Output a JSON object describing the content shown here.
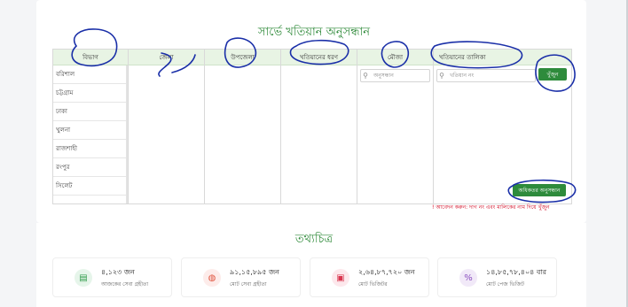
{
  "page": {
    "main_title": "সার্ভে খতিয়ান অনুসন্ধান",
    "info_title": "তথ্যচিত্র"
  },
  "columns": {
    "division": "বিভাগ",
    "district": "জেলা",
    "upazila": "উপজেলা",
    "khatian_type": "খতিয়ানের ধরণ",
    "mouza": "মৌজা",
    "khatian_list": "খতিয়ানের তালিকা"
  },
  "divisions": [
    "বরিশাল",
    "চট্টগ্রাম",
    "ঢাকা",
    "খুলনা",
    "রাজশাহী",
    "রংপুর",
    "সিলেট"
  ],
  "mouza_search": {
    "placeholder": "অনুসন্ধান"
  },
  "khatian_search": {
    "placeholder": "খতিয়ান নং"
  },
  "buttons": {
    "search": "খুঁজুন",
    "advanced_search": "অধিকতর অনুসন্ধান"
  },
  "notice": "! আবেদন করুন: দাগ নং এবং মালিকের নাম দিয়ে খুঁজুন",
  "stats": [
    {
      "value": "৪,১২৩ জন",
      "label": "আজকের সেবা গ্রহীতা",
      "icon": "document-icon",
      "color": "#2e9b4a",
      "bg": "#e6f5ea"
    },
    {
      "value": "৯১,১৫,৮৯৫ জন",
      "label": "মোট সেবা গ্রহীতা",
      "icon": "globe-icon",
      "color": "#e0523c",
      "bg": "#fdecea"
    },
    {
      "value": "২,৬৪,৮৭,৭২০ জন",
      "label": "মোট ভিজিটর",
      "icon": "file-icon",
      "color": "#d9364f",
      "bg": "#fde8ec"
    },
    {
      "value": "১৪,৮৫,৭৮,৪০৪ বার",
      "label": "মোট পেজ ভিজিট",
      "icon": "percent-icon",
      "color": "#8a4fbf",
      "bg": "#f1e9f8"
    }
  ]
}
